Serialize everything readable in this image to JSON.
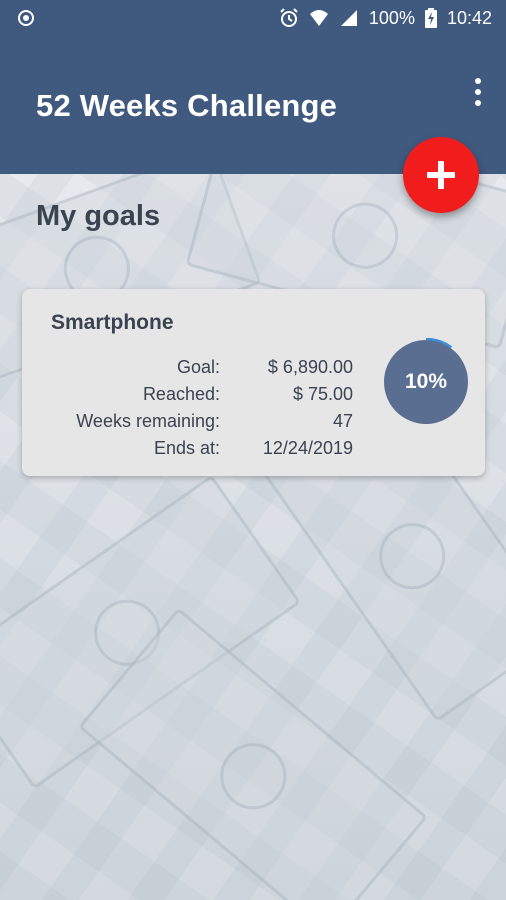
{
  "status_bar": {
    "battery": "100%",
    "time": "10:42"
  },
  "app_bar": {
    "title": "52 Weeks Challenge"
  },
  "main": {
    "section_title": "My goals",
    "goals": [
      {
        "name": "Smartphone",
        "rows": [
          {
            "label": "Goal:",
            "value": "$ 6,890.00"
          },
          {
            "label": "Reached:",
            "value": "$ 75.00"
          },
          {
            "label": "Weeks remaining:",
            "value": "47"
          },
          {
            "label": "Ends at:",
            "value": "12/24/2019"
          }
        ],
        "progress_text": "10%",
        "progress": 0.1
      }
    ]
  },
  "colors": {
    "app_bar": "#40597f",
    "fab": "#f11d1d",
    "progress_circle": "#5a6e91",
    "progress_arc": "#3a8fd8"
  }
}
